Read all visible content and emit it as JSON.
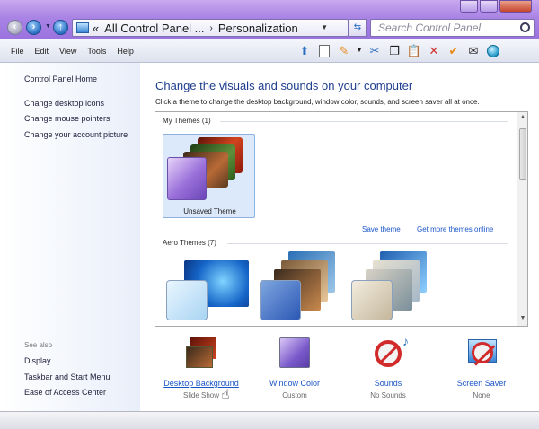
{
  "window": {
    "breadcrumb": [
      "«",
      "All Control Panel ...",
      "Personalization"
    ],
    "search_placeholder": "Search Control Panel"
  },
  "menu": [
    "File",
    "Edit",
    "View",
    "Tools",
    "Help"
  ],
  "toolbar_icons": [
    "up-arrow-icon",
    "blank-page-icon",
    "highlighter-icon",
    "scissors-icon",
    "copy-icon",
    "clipboard-icon",
    "delete-x-icon",
    "checkmark-icon",
    "email-icon",
    "globe-icon"
  ],
  "sidebar": {
    "home": "Control Panel Home",
    "links": [
      "Change desktop icons",
      "Change mouse pointers",
      "Change your account picture"
    ],
    "see_also_title": "See also",
    "see_also": [
      "Display",
      "Taskbar and Start Menu",
      "Ease of Access Center"
    ]
  },
  "main": {
    "title": "Change the visuals and sounds on your computer",
    "subtitle": "Click a theme to change the desktop background, window color, sounds, and screen saver all at once.",
    "my_themes_label": "My Themes (1)",
    "unsaved_theme": "Unsaved Theme",
    "save_theme": "Save theme",
    "more_themes": "Get more themes online",
    "aero_themes_label": "Aero Themes (7)"
  },
  "settings": [
    {
      "label": "Desktop Background",
      "value": "Slide Show"
    },
    {
      "label": "Window Color",
      "value": "Custom"
    },
    {
      "label": "Sounds",
      "value": "No Sounds"
    },
    {
      "label": "Screen Saver",
      "value": "None"
    }
  ],
  "colors": {
    "accent_link": "#1a55c8",
    "title_blue": "#1e3d8f",
    "chrome_purple": "#a983e4"
  }
}
